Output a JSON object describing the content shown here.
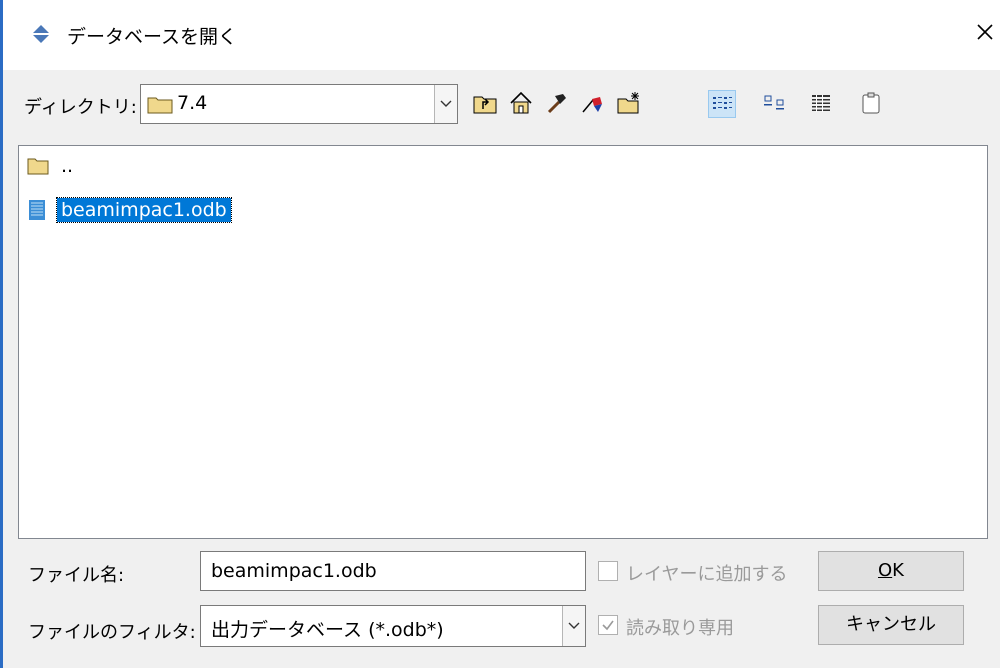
{
  "window": {
    "title": "データベースを開く"
  },
  "toolbar": {
    "directory_label": "ディレクトリ:",
    "directory_value": "7.4",
    "buttons": [
      "up-folder-icon",
      "home-icon",
      "hammer-icon",
      "bookmark-icon",
      "new-folder-icon",
      "list-view-icon",
      "icon-view-icon",
      "details-view-icon",
      "clipboard-icon"
    ]
  },
  "files": [
    {
      "name": "..",
      "type": "folder"
    },
    {
      "name": "beamimpac1.odb",
      "type": "file",
      "selected": true
    }
  ],
  "footer": {
    "filename_label": "ファイル名:",
    "filename_value": "beamimpac1.odb",
    "filter_label": "ファイルのフィルタ:",
    "filter_value": "出力データベース (*.odb*)",
    "add_layer_label": "レイヤーに追加する",
    "readonly_label": "読み取り専用",
    "ok_mnemonic": "O",
    "ok_rest": "K",
    "cancel_label": "キャンセル"
  },
  "colors": {
    "selection": "#0078d7",
    "folder": "#f0d88c",
    "accent": "#2b6cc4"
  }
}
